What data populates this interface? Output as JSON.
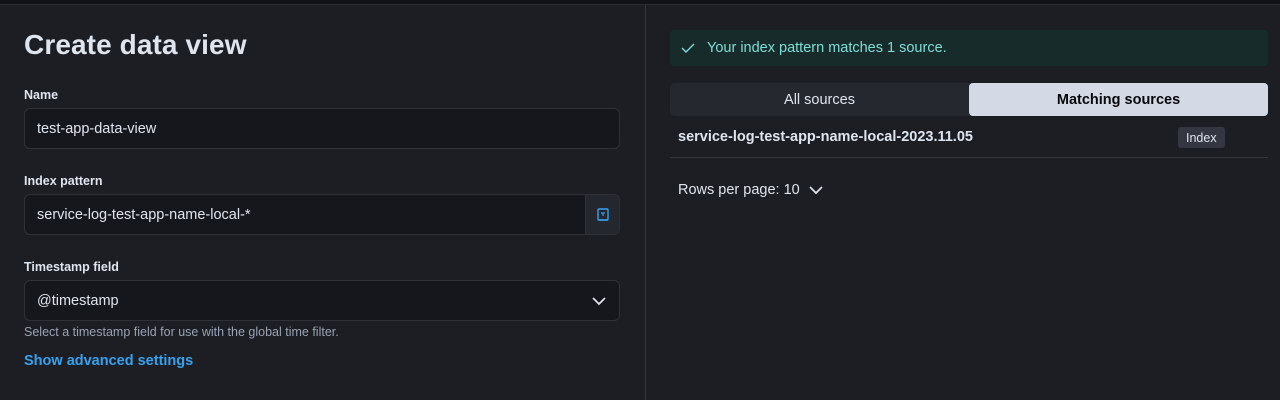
{
  "left_panel": {
    "title": "Create data view",
    "name_field": {
      "label": "Name",
      "value": "test-app-data-view"
    },
    "index_pattern_field": {
      "label": "Index pattern",
      "value": "service-log-test-app-name-local-*",
      "append_icon": "index-pattern-icon"
    },
    "timestamp_field": {
      "label": "Timestamp field",
      "value": "@timestamp",
      "help": "Select a timestamp field for use with the global time filter.",
      "caret_icon": "chevron-down-icon"
    },
    "advanced_link": "Show advanced settings"
  },
  "right_panel": {
    "callout": {
      "icon": "check-icon",
      "text": "Your index pattern matches 1 source."
    },
    "tabs": [
      {
        "label": "All sources",
        "active": false
      },
      {
        "label": "Matching sources",
        "active": true
      }
    ],
    "table": {
      "rows": [
        {
          "name": "service-log-test-app-name-local-2023.11.05",
          "type": "Index"
        }
      ]
    },
    "pagination": {
      "label": "Rows per page:",
      "value": "10",
      "caret_icon": "chevron-down-icon"
    }
  },
  "colors": {
    "background": "#1d1e24",
    "input_background": "#16171c",
    "link": "#36a2ef",
    "success_text": "#7dded8",
    "success_background": "#172b2a",
    "active_tab_background": "#d4dae5"
  }
}
